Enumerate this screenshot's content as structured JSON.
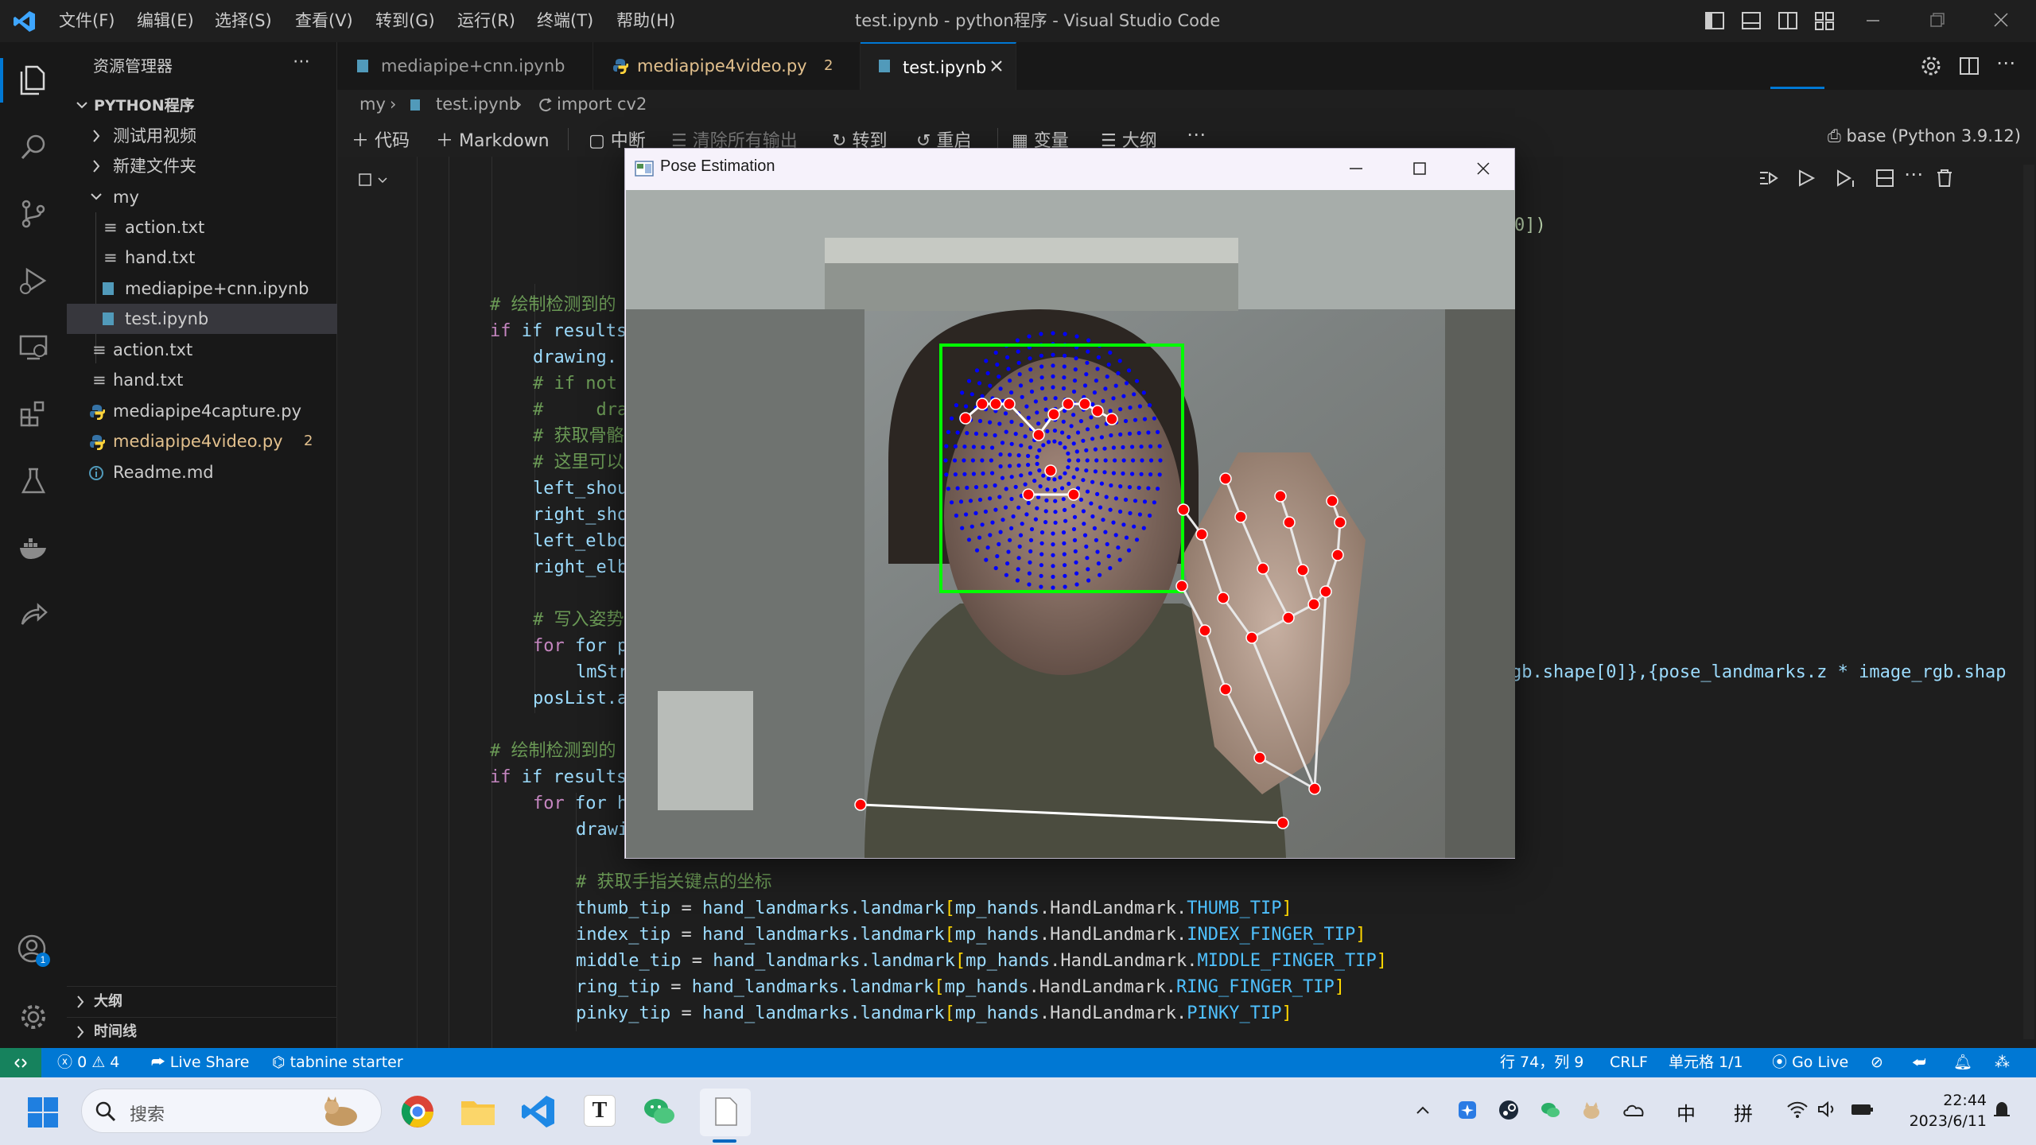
{
  "titlebar": {
    "menus": [
      "文件(F)",
      "编辑(E)",
      "选择(S)",
      "查看(V)",
      "转到(G)",
      "运行(R)",
      "终端(T)",
      "帮助(H)"
    ],
    "title": "test.ipynb - python程序 - Visual Studio Code"
  },
  "sidebar": {
    "header": "资源管理器",
    "root": "PYTHON程序",
    "items": [
      {
        "label": "测试用视频",
        "kind": "folder"
      },
      {
        "label": "新建文件夹",
        "kind": "folder"
      },
      {
        "label": "my",
        "kind": "folder-open"
      },
      {
        "label": "action.txt",
        "kind": "text"
      },
      {
        "label": "hand.txt",
        "kind": "text"
      },
      {
        "label": "mediapipe+cnn.ipynb",
        "kind": "notebook"
      },
      {
        "label": "test.ipynb",
        "kind": "notebook"
      },
      {
        "label": "action.txt",
        "kind": "text"
      },
      {
        "label": "hand.txt",
        "kind": "text"
      },
      {
        "label": "mediapipe4capture.py",
        "kind": "python"
      },
      {
        "label": "mediapipe4video.py",
        "kind": "python",
        "badge": "2"
      },
      {
        "label": "Readme.md",
        "kind": "info"
      }
    ],
    "outline": "大纲",
    "timeline": "时间线"
  },
  "tabs": [
    {
      "label": "mediapipe+cnn.ipynb"
    },
    {
      "label": "mediapipe4video.py",
      "badge": "2"
    },
    {
      "label": "test.ipynb"
    }
  ],
  "breadcrumbs": {
    "folder": "my",
    "file": "test.ipynb",
    "symbol": "import cv2"
  },
  "toolbar": {
    "code": "代码",
    "markdown": "Markdown",
    "interrupt": "中断",
    "clear": "清除所有输出",
    "goto": "转到",
    "restart": "重启",
    "variables": "变量",
    "outline": "大纲",
    "kernel": "base (Python 3.9.12)"
  },
  "code": {
    "line_top_fragment": "0])",
    "c1": "# 绘制检测到的",
    "l1": "if results.po",
    "l2": "drawing.",
    "l3": "# if not",
    "l4": "#     dra",
    "l5": "# 获取骨骼",
    "l6": "# 这里可以",
    "l7": "left_shou",
    "l8": "right_sho",
    "l9": "left_elbo",
    "l10": "right_elb",
    "l11": "# 写入姿势",
    "l12": "for pose_",
    "l13": "lmStr",
    "l14": "posList.a",
    "l12_right": "gb.shape[0]},{pose_landmarks.z * image_rgb.shap",
    "c2": "# 绘制检测到的",
    "l15": "if results2.m",
    "l16": "for hand_",
    "l17": "drawi",
    "comment_tips": "# 获取手指关键点的坐标",
    "thumb": {
      "var": "thumb_tip",
      "tip": "THUMB_TIP"
    },
    "index": {
      "var": "index_tip",
      "tip": "INDEX_FINGER_TIP"
    },
    "middle": {
      "var": "middle_tip",
      "tip": "MIDDLE_FINGER_TIP"
    },
    "ring": {
      "var": "ring_tip",
      "tip": "RING_FINGER_TIP"
    },
    "pinky": {
      "var": "pinky_tip",
      "tip": "PINKY_TIP"
    },
    "eq": " = ",
    "hl": "hand_landmarks",
    "landmark": ".landmark",
    "mp": "mp_hands",
    "enum": ".HandLandmark.",
    "lb": "[",
    "rb": "]"
  },
  "posewindow": {
    "title": "Pose Estimation"
  },
  "statusbar": {
    "errors": "0",
    "warnings": "4",
    "liveshare": "Live Share",
    "tabnine": "tabnine starter",
    "position": "行 74，列 9",
    "eol": "CRLF",
    "cell": "单元格 1/1",
    "golive": "Go Live"
  },
  "taskbar": {
    "search": "搜索",
    "ime1": "中",
    "ime2": "拼",
    "time": "22:44",
    "date": "2023/6/11"
  },
  "colors": {
    "accent": "#0078d4",
    "status_bar": "#0078d4",
    "keyword": "#569cd6",
    "variable": "#9cdcfe",
    "comment": "#6a9955",
    "constant": "#4fc1ff",
    "modified_file": "#e2c08d",
    "landmark_red": "#ff0000",
    "mesh_blue": "#0000ff",
    "box_green": "#00ff00"
  }
}
